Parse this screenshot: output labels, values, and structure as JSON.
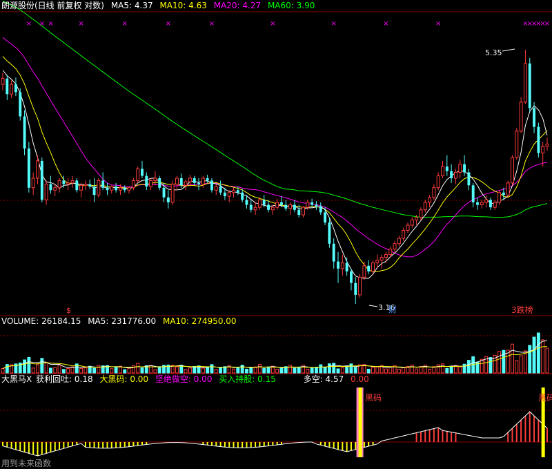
{
  "header": {
    "title": "朗源股份(日线 前复权 对数)",
    "ma5": "MA5: 4.37",
    "ma10": "MA10: 4.63",
    "ma20": "MA20: 4.27",
    "ma60": "MA60: 3.90"
  },
  "volume_header": {
    "volume": "VOLUME: 26184.15",
    "ma5": "MA5: 231776.00",
    "ma10": "MA10: 274950.00"
  },
  "indicator_header": {
    "name": "大黑马X",
    "profit": "获利回吐: 0.18",
    "dark_horse": "大黑码: 0.00",
    "short": "坚绝做空: 0.00",
    "hold": "买入持股: 0.15",
    "longshort": "多空: 4.57",
    "extra": "0.00"
  },
  "annotations": {
    "high_label": "5.35",
    "low_label": "3.16",
    "cai_label": "财",
    "s_marker": "$",
    "longhu_label": "3跌榜",
    "heima1": "黑码",
    "heima2": "黑码",
    "watermark": "用到未来函数"
  },
  "colors": {
    "up": "#ff3c3c",
    "down": "#54fcfc",
    "ma5": "#ffffff",
    "ma10": "#ffff00",
    "ma20": "#ff00ff",
    "ma60": "#00ff00",
    "grid": "#8b0000",
    "marker": "#ff00ff"
  },
  "chart_data": {
    "type": "candlestick",
    "price_scale": "log",
    "ylim": [
      3.16,
      5.35
    ],
    "candles": [
      [
        4.98,
        5.1,
        4.92,
        5.04
      ],
      [
        5.04,
        5.08,
        4.82,
        4.88
      ],
      [
        4.88,
        5.02,
        4.84,
        4.98
      ],
      [
        4.98,
        5.05,
        4.86,
        4.9
      ],
      [
        4.9,
        4.94,
        4.62,
        4.66
      ],
      [
        4.66,
        4.72,
        4.3,
        4.36
      ],
      [
        4.36,
        4.42,
        3.98,
        4.02
      ],
      [
        4.02,
        4.15,
        3.96,
        4.1
      ],
      [
        4.1,
        4.3,
        4.05,
        4.25
      ],
      [
        4.25,
        4.28,
        3.9,
        3.92
      ],
      [
        3.92,
        4.08,
        3.88,
        4.05
      ],
      [
        4.05,
        4.12,
        3.97,
        4.0
      ],
      [
        4.0,
        4.05,
        3.95,
        4.02
      ],
      [
        4.02,
        4.1,
        3.98,
        4.08
      ],
      [
        4.08,
        4.12,
        4.02,
        4.05
      ],
      [
        4.05,
        4.1,
        4.0,
        4.06
      ],
      [
        4.06,
        4.12,
        4.02,
        4.08
      ],
      [
        4.08,
        4.1,
        3.98,
        4.0
      ],
      [
        4.0,
        4.06,
        3.94,
        4.04
      ],
      [
        4.04,
        4.08,
        4.0,
        4.05
      ],
      [
        4.05,
        4.09,
        4.01,
        4.03
      ],
      [
        4.03,
        4.1,
        3.9,
        3.96
      ],
      [
        3.96,
        4.1,
        3.94,
        4.08
      ],
      [
        4.08,
        4.15,
        4.0,
        4.02
      ],
      [
        4.02,
        4.06,
        3.96,
        4.0
      ],
      [
        4.0,
        4.04,
        3.97,
        4.03
      ],
      [
        4.03,
        4.06,
        3.98,
        4.0
      ],
      [
        4.0,
        4.05,
        3.96,
        4.02
      ],
      [
        4.02,
        4.04,
        3.98,
        4.0
      ],
      [
        4.0,
        4.03,
        3.97,
        4.02
      ],
      [
        4.02,
        4.1,
        4.0,
        4.08
      ],
      [
        4.08,
        4.2,
        4.06,
        4.18
      ],
      [
        4.18,
        4.25,
        4.1,
        4.12
      ],
      [
        4.12,
        4.15,
        4.0,
        4.03
      ],
      [
        4.03,
        4.1,
        4.0,
        4.08
      ],
      [
        4.08,
        4.16,
        4.04,
        4.1
      ],
      [
        4.1,
        4.12,
        4.0,
        4.02
      ],
      [
        4.02,
        4.06,
        3.9,
        3.94
      ],
      [
        3.94,
        4.0,
        3.85,
        3.9
      ],
      [
        3.9,
        4.08,
        3.88,
        4.05
      ],
      [
        4.05,
        4.12,
        4.0,
        4.1
      ],
      [
        4.1,
        4.14,
        4.02,
        4.04
      ],
      [
        4.04,
        4.09,
        4.0,
        4.07
      ],
      [
        4.07,
        4.13,
        4.03,
        4.1
      ],
      [
        4.1,
        4.12,
        4.04,
        4.06
      ],
      [
        4.06,
        4.1,
        4.0,
        4.05
      ],
      [
        4.05,
        4.12,
        4.02,
        4.1
      ],
      [
        4.1,
        4.13,
        4.06,
        4.08
      ],
      [
        4.08,
        4.1,
        3.98,
        4.0
      ],
      [
        4.0,
        4.05,
        3.96,
        4.03
      ],
      [
        4.03,
        4.08,
        3.96,
        3.98
      ],
      [
        3.98,
        4.02,
        3.92,
        3.95
      ],
      [
        3.95,
        4.0,
        3.9,
        3.98
      ],
      [
        3.98,
        4.02,
        3.94,
        4.0
      ],
      [
        4.0,
        4.03,
        3.96,
        3.98
      ],
      [
        3.98,
        4.01,
        3.9,
        3.92
      ],
      [
        3.92,
        3.96,
        3.85,
        3.88
      ],
      [
        3.88,
        3.92,
        3.82,
        3.84
      ],
      [
        3.84,
        3.9,
        3.8,
        3.86
      ],
      [
        3.86,
        3.94,
        3.84,
        3.92
      ],
      [
        3.92,
        3.96,
        3.86,
        3.88
      ],
      [
        3.88,
        3.92,
        3.82,
        3.84
      ],
      [
        3.84,
        3.88,
        3.8,
        3.86
      ],
      [
        3.86,
        3.93,
        3.84,
        3.9
      ],
      [
        3.9,
        3.95,
        3.86,
        3.88
      ],
      [
        3.88,
        3.92,
        3.83,
        3.85
      ],
      [
        3.85,
        3.9,
        3.8,
        3.88
      ],
      [
        3.88,
        3.92,
        3.82,
        3.84
      ],
      [
        3.84,
        3.88,
        3.78,
        3.8
      ],
      [
        3.8,
        3.87,
        3.78,
        3.86
      ],
      [
        3.86,
        3.92,
        3.84,
        3.9
      ],
      [
        3.9,
        3.93,
        3.86,
        3.88
      ],
      [
        3.88,
        3.91,
        3.84,
        3.87
      ],
      [
        3.87,
        3.9,
        3.8,
        3.82
      ],
      [
        3.82,
        3.86,
        3.72,
        3.74
      ],
      [
        3.74,
        3.78,
        3.55,
        3.58
      ],
      [
        3.58,
        3.62,
        3.4,
        3.45
      ],
      [
        3.45,
        3.52,
        3.3,
        3.4
      ],
      [
        3.4,
        3.5,
        3.35,
        3.44
      ],
      [
        3.44,
        3.48,
        3.35,
        3.38
      ],
      [
        3.38,
        3.4,
        3.25,
        3.3
      ],
      [
        3.3,
        3.34,
        3.16,
        3.22
      ],
      [
        3.22,
        3.36,
        3.2,
        3.34
      ],
      [
        3.34,
        3.45,
        3.32,
        3.42
      ],
      [
        3.42,
        3.46,
        3.36,
        3.38
      ],
      [
        3.38,
        3.46,
        3.36,
        3.44
      ],
      [
        3.44,
        3.5,
        3.4,
        3.46
      ],
      [
        3.46,
        3.5,
        3.4,
        3.48
      ],
      [
        3.48,
        3.52,
        3.44,
        3.5
      ],
      [
        3.5,
        3.56,
        3.48,
        3.54
      ],
      [
        3.54,
        3.6,
        3.52,
        3.58
      ],
      [
        3.58,
        3.64,
        3.56,
        3.62
      ],
      [
        3.62,
        3.7,
        3.6,
        3.68
      ],
      [
        3.68,
        3.74,
        3.66,
        3.72
      ],
      [
        3.72,
        3.78,
        3.7,
        3.76
      ],
      [
        3.76,
        3.8,
        3.72,
        3.78
      ],
      [
        3.78,
        3.86,
        3.76,
        3.84
      ],
      [
        3.84,
        3.92,
        3.82,
        3.9
      ],
      [
        3.9,
        3.96,
        3.86,
        3.94
      ],
      [
        3.94,
        4.05,
        3.92,
        4.02
      ],
      [
        4.02,
        4.15,
        4.0,
        4.12
      ],
      [
        4.12,
        4.25,
        4.1,
        4.2
      ],
      [
        4.2,
        4.3,
        4.12,
        4.16
      ],
      [
        4.16,
        4.22,
        4.06,
        4.1
      ],
      [
        4.1,
        4.18,
        4.05,
        4.15
      ],
      [
        4.15,
        4.26,
        4.1,
        4.22
      ],
      [
        4.22,
        4.3,
        4.12,
        4.15
      ],
      [
        4.15,
        4.18,
        4.0,
        4.04
      ],
      [
        4.04,
        4.06,
        3.86,
        3.9
      ],
      [
        3.9,
        3.94,
        3.84,
        3.88
      ],
      [
        3.88,
        3.92,
        3.85,
        3.9
      ],
      [
        3.9,
        3.96,
        3.86,
        3.92
      ],
      [
        3.92,
        3.94,
        3.84,
        3.86
      ],
      [
        3.86,
        3.92,
        3.84,
        3.9
      ],
      [
        3.9,
        4.0,
        3.88,
        3.98
      ],
      [
        3.98,
        4.02,
        3.92,
        3.96
      ],
      [
        3.96,
        4.08,
        3.94,
        4.06
      ],
      [
        4.06,
        4.3,
        4.04,
        4.28
      ],
      [
        4.28,
        4.55,
        4.26,
        4.52
      ],
      [
        4.52,
        4.85,
        4.5,
        4.8
      ],
      [
        4.8,
        5.35,
        4.78,
        5.2
      ],
      [
        5.2,
        5.26,
        4.7,
        4.74
      ],
      [
        4.74,
        4.8,
        4.5,
        4.56
      ],
      [
        4.56,
        4.6,
        4.28,
        4.32
      ],
      [
        4.32,
        4.42,
        4.2,
        4.38
      ],
      [
        4.38,
        4.46,
        4.34,
        4.4
      ]
    ],
    "volume_header_values": {
      "volume": 26184.15,
      "ma5": 231776.0,
      "ma10": 274950.0
    },
    "indicator_values": {
      "profit": 0.18,
      "dark_horse": 0.0,
      "short": 0.0,
      "hold": 0.15,
      "longshort": 4.57
    }
  }
}
